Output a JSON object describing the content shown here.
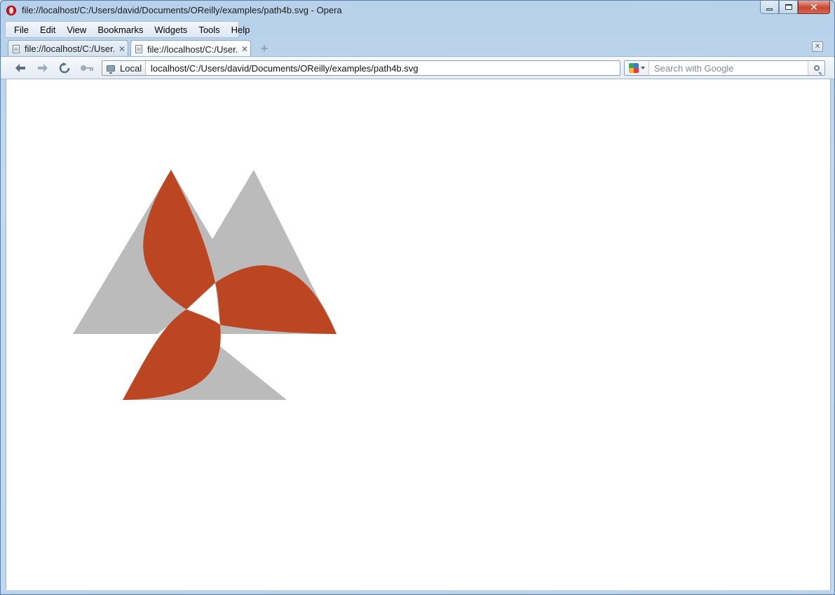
{
  "window": {
    "title": "file://localhost/C:/Users/david/Documents/OReilly/examples/path4b.svg - Opera",
    "controls": {
      "minimize": "minimize",
      "maximize": "maximize",
      "close": "✕"
    }
  },
  "menubar": {
    "items": [
      "File",
      "Edit",
      "View",
      "Bookmarks",
      "Widgets",
      "Tools",
      "Help"
    ]
  },
  "tabs": [
    {
      "label": "file://localhost/C:/User...",
      "close": "✕",
      "active": false
    },
    {
      "label": "file://localhost/C:/User...",
      "close": "✕",
      "active": true
    }
  ],
  "navbar": {
    "site_badge": "Local",
    "address": "localhost/C:/Users/david/Documents/OReilly/examples/path4b.svg",
    "search_placeholder": "Search with Google"
  },
  "icons": {
    "app": "opera-icon",
    "back": "back-arrow-icon",
    "forward": "forward-arrow-icon",
    "reload": "reload-icon",
    "wand": "key-icon",
    "new_tab": "plus-icon",
    "trash": "closed-tabs-icon",
    "search": "search-icon",
    "engine": "google-icon"
  },
  "colors": {
    "triangle_gray": "#bbbbbb",
    "petal_orange": "#bc4522",
    "page_background": "#ffffff"
  }
}
